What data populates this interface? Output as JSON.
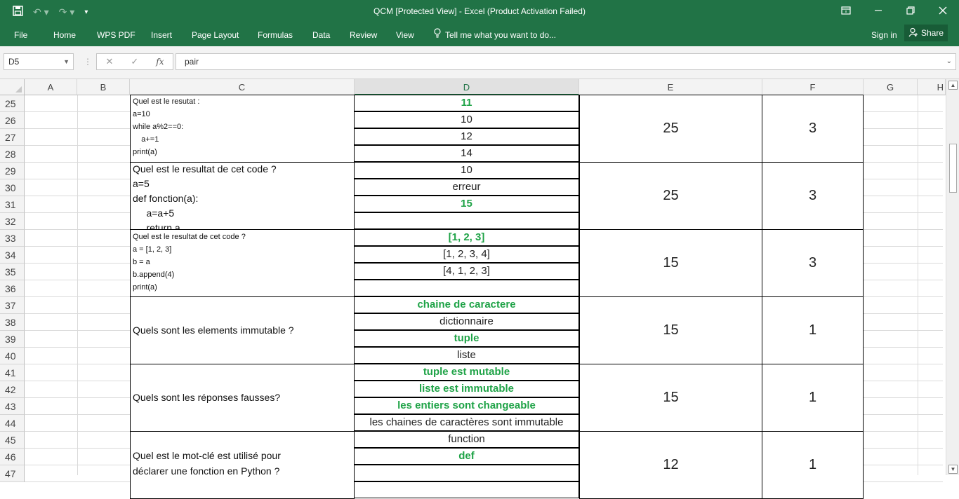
{
  "app": {
    "title": "QCM  [Protected View] - Excel (Product Activation Failed)"
  },
  "quick_access": {
    "save_icon": "save-icon",
    "undo_icon": "undo-icon",
    "redo_icon": "redo-icon",
    "customize_icon": "customize-icon"
  },
  "window_controls": {
    "ribbon_display_icon": "ribbon-display-icon",
    "minimize_icon": "minimize-icon",
    "restore_icon": "restore-icon",
    "close_icon": "close-icon"
  },
  "ribbon": {
    "tabs": [
      "File",
      "Home",
      "WPS PDF",
      "Insert",
      "Page Layout",
      "Formulas",
      "Data",
      "Review",
      "View"
    ],
    "tell_me": "Tell me what you want to do...",
    "sign_in": "Sign in",
    "share": "Share"
  },
  "formula_bar": {
    "name_box": "D5",
    "cancel_icon": "✕",
    "enter_icon": "✓",
    "fx_label": "fx",
    "content": "pair"
  },
  "columns": [
    "A",
    "B",
    "C",
    "D",
    "E",
    "F",
    "G",
    "H"
  ],
  "rows": [
    "25",
    "26",
    "27",
    "28",
    "29",
    "30",
    "31",
    "32",
    "33",
    "34",
    "35",
    "36",
    "37",
    "38",
    "39",
    "40",
    "41",
    "42",
    "43",
    "44",
    "45",
    "46",
    "47"
  ],
  "sheet": {
    "blocks": [
      {
        "question_lines": [
          "Quel est le resutat :",
          "a=10",
          "while a%2==0:",
          "    a+=1",
          "print(a)"
        ],
        "answers": [
          {
            "text": "11",
            "correct": true
          },
          {
            "text": "10",
            "correct": false
          },
          {
            "text": "12",
            "correct": false
          },
          {
            "text": "14",
            "correct": false
          }
        ],
        "e": "25",
        "f": "3"
      },
      {
        "question_lines": [
          "Quel est le resultat de cet code ?",
          "a=5",
          "def fonction(a):",
          "     a=a+5",
          "     return a"
        ],
        "answers": [
          {
            "text": "10",
            "correct": false
          },
          {
            "text": "erreur",
            "correct": false
          },
          {
            "text": "15",
            "correct": true
          },
          {
            "text": "",
            "correct": false
          }
        ],
        "e": "25",
        "f": "3"
      },
      {
        "question_lines": [
          "Quel est le resultat de cet code ?",
          "a = [1, 2, 3]",
          "b = a",
          "b.append(4)",
          "print(a)"
        ],
        "answers": [
          {
            "text": "[1, 2, 3]",
            "correct": true
          },
          {
            "text": "[1, 2, 3, 4]",
            "correct": false
          },
          {
            "text": "[4, 1, 2, 3]",
            "correct": false
          },
          {
            "text": "",
            "correct": false
          }
        ],
        "e": "15",
        "f": "3"
      },
      {
        "question_lines": [
          "Quels sont les elements immutable ?"
        ],
        "answers": [
          {
            "text": "chaine de caractere",
            "correct": true
          },
          {
            "text": "dictionnaire",
            "correct": false
          },
          {
            "text": "tuple",
            "correct": true
          },
          {
            "text": "liste",
            "correct": false
          }
        ],
        "e": "15",
        "f": "1"
      },
      {
        "question_lines": [
          "Quels sont les réponses fausses?"
        ],
        "answers": [
          {
            "text": "tuple est mutable",
            "correct": true
          },
          {
            "text": "liste est immutable",
            "correct": true
          },
          {
            "text": "les entiers sont changeable",
            "correct": true
          },
          {
            "text": "les chaines de caractères sont immutable",
            "correct": false
          }
        ],
        "e": "15",
        "f": "1"
      },
      {
        "question_lines": [
          "Quel est le mot-clé est utilisé pour",
          "déclarer une fonction en Python ?"
        ],
        "answers": [
          {
            "text": "function",
            "correct": false
          },
          {
            "text": "def",
            "correct": true
          },
          {
            "text": "",
            "correct": false
          }
        ],
        "e": "12",
        "f": "1"
      }
    ]
  },
  "colors": {
    "excel_green": "#217346",
    "correct_answer": "#1fa347"
  }
}
